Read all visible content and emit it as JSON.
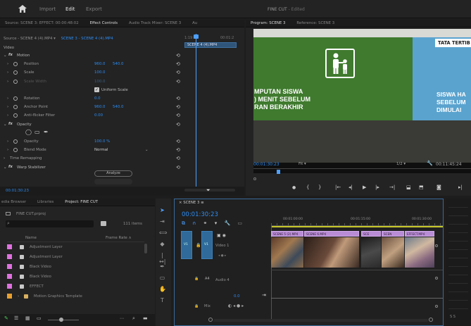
{
  "topbar": {
    "home_icon": "home-icon",
    "tabs": [
      "Import",
      "Edit",
      "Export"
    ],
    "active_tab": "Edit",
    "project_title": "FINE CUT",
    "project_status": "- Edited"
  },
  "effect_panel": {
    "tabs": [
      "Source: SCENE 3: EFFECT: 00:00:48:02",
      "Effect Controls",
      "Audio Track Mixer: SCENE 3",
      "Au"
    ],
    "source": "Source - SCENE 4 (4).MP4",
    "sequence": "SCENE 3 - SCENE 4 (4).MP4",
    "ruler_start": "1:19:00",
    "ruler_end": "00:01:2",
    "clip_bar": "SCENE 4 (4).MP4",
    "section_video": "Video",
    "params": [
      {
        "name": "Motion",
        "value": "",
        "value2": "",
        "kind": "fx"
      },
      {
        "name": "Position",
        "value": "960.0",
        "value2": "540.0",
        "kind": "param"
      },
      {
        "name": "Scale",
        "value": "100.0",
        "value2": "",
        "kind": "param"
      },
      {
        "name": "Scale Width",
        "value": "100.0",
        "value2": "",
        "kind": "param-disabled"
      },
      {
        "name": "Uniform Scale",
        "value": "",
        "value2": "",
        "kind": "checkbox"
      },
      {
        "name": "Rotation",
        "value": "0.0",
        "value2": "",
        "kind": "param"
      },
      {
        "name": "Anchor Point",
        "value": "960.0",
        "value2": "540.0",
        "kind": "param"
      },
      {
        "name": "Anti-flicker Filter",
        "value": "0.00",
        "value2": "",
        "kind": "param"
      },
      {
        "name": "Opacity",
        "value": "",
        "value2": "",
        "kind": "fx"
      },
      {
        "name": "",
        "value": "",
        "value2": "",
        "kind": "masks"
      },
      {
        "name": "Opacity",
        "value": "100.0 %",
        "value2": "",
        "kind": "param"
      },
      {
        "name": "Blend Mode",
        "value": "Normal",
        "value2": "",
        "kind": "select"
      },
      {
        "name": "Time Remapping",
        "value": "",
        "value2": "",
        "kind": "section"
      },
      {
        "name": "Warp Stabilizer",
        "value": "",
        "value2": "",
        "kind": "fx"
      }
    ],
    "analyze_button": "Analyze",
    "timecode": "00:01:30:23"
  },
  "program": {
    "tabs": [
      "Program: SCENE 3",
      "Reference: SCENE 3"
    ],
    "scene_text_left": [
      "MPUTAN SISWA",
      ") MENIT SEBELUM",
      "RAN BERAKHIR"
    ],
    "scene_text_right": [
      "SISWA HA",
      "SEBELUM",
      "DIMULAI"
    ],
    "scene_top_right": "TATA TERTIB",
    "timecode": "00:01:30:23",
    "fit": "Fit",
    "resolution": "1/2",
    "duration": "00:11:45:24"
  },
  "project": {
    "tabs": [
      "edia Browser",
      "Libraries",
      "Project: FINE CUT"
    ],
    "file": "FINE CUT.prproj",
    "items_count": "111 items",
    "col_name": "Name",
    "col_rate": "Frame Rate",
    "items": [
      {
        "name": "Adjustment Layer",
        "color": "#e070e0",
        "type": "clip"
      },
      {
        "name": "Adjustment Layer",
        "color": "#e070e0",
        "type": "clip"
      },
      {
        "name": "Black Video",
        "color": "#e070e0",
        "type": "clip"
      },
      {
        "name": "Black Video",
        "color": "#e070e0",
        "type": "clip"
      },
      {
        "name": "EFFECT",
        "color": "#e070e0",
        "type": "clip"
      },
      {
        "name": "Motion Graphics Template",
        "color": "#e8a030",
        "type": "folder"
      }
    ]
  },
  "timeline": {
    "tab": "SCENE 3",
    "timecode": "00:01:30:23",
    "ruler": [
      "00:01:00:00",
      "00:01:15:00",
      "00:01:30:00"
    ],
    "track_v1": "Video 1",
    "track_a": "Audio 4",
    "mix_value": "0.0",
    "mix_label": "Mix",
    "clips": [
      "SCENE 5 (2).MP4",
      "SCENE 6.MP4",
      "SCE",
      "SCEN",
      "EFFECT.MP4"
    ],
    "clip_codes": [
      "V1",
      "V1"
    ]
  },
  "colors": {
    "accent": "#2c8cf2",
    "playhead": "#4da0ff",
    "green_wall": "#3f7a2e",
    "clip": "#b98cd6"
  }
}
